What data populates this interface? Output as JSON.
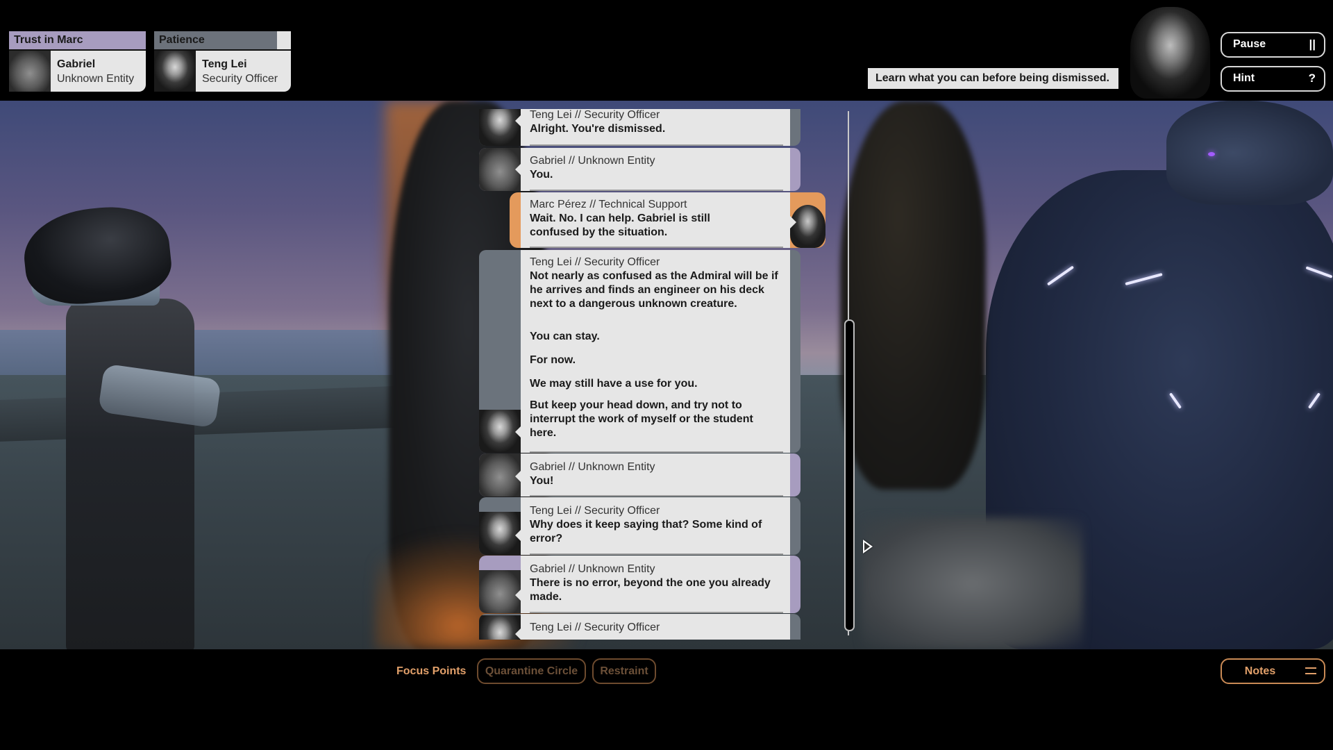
{
  "hud": {
    "stats": [
      {
        "label": "Trust in Marc",
        "value_fraction": 1.0,
        "color": "#a79cbf",
        "character": {
          "name": "Gabriel",
          "role": "Unknown Entity"
        }
      },
      {
        "label": "Patience",
        "value_fraction": 0.9,
        "color": "#6c727b",
        "character": {
          "name": "Teng Lei",
          "role": "Security Officer"
        }
      }
    ],
    "objective": "Learn what you can before being dismissed.",
    "player_portrait": "Marc Pérez",
    "buttons": {
      "pause": {
        "label": "Pause",
        "icon": "||"
      },
      "hint": {
        "label": "Hint",
        "icon": "?"
      }
    }
  },
  "dialogue": {
    "messages": [
      {
        "speaker": "Teng Lei // Security Officer",
        "character": "teng",
        "lines": [
          "Alright. You're dismissed."
        ]
      },
      {
        "speaker": "Gabriel // Unknown Entity",
        "character": "gabriel",
        "lines": [
          "You."
        ]
      },
      {
        "speaker": "Marc Pérez // Technical Support",
        "character": "marc",
        "lines": [
          "Wait. No. I can help. Gabriel is still confused by the situation."
        ]
      },
      {
        "speaker": "Teng Lei // Security Officer",
        "character": "teng",
        "lines": [
          "Not nearly as confused as the Admiral will be if he arrives and finds an engineer on his deck next to a dangerous unknown creature.",
          "You can stay.",
          "For now.",
          "We may still have a use for you.",
          "But keep your head down, and try not to interrupt the work of myself or the student here."
        ]
      },
      {
        "speaker": "Gabriel // Unknown Entity",
        "character": "gabriel",
        "lines": [
          "You!"
        ]
      },
      {
        "speaker": "Teng Lei // Security Officer",
        "character": "teng",
        "lines": [
          "Why does it keep saying that? Some kind of error?"
        ]
      },
      {
        "speaker": "Gabriel // Unknown Entity",
        "character": "gabriel",
        "lines": [
          "There is no error, beyond the one you already made."
        ]
      },
      {
        "speaker": "Teng Lei // Security Officer",
        "character": "teng",
        "lines": []
      }
    ],
    "scroll_position_fraction": 0.6
  },
  "bottom": {
    "focus_label": "Focus Points",
    "focus_points": [
      "Quarantine Circle",
      "Restraint"
    ],
    "notes_label": "Notes"
  },
  "colors": {
    "teng": "#6b737c",
    "gabriel": "#a79cbf",
    "marc": "#e49a5c",
    "accent": "#e2a06a"
  }
}
